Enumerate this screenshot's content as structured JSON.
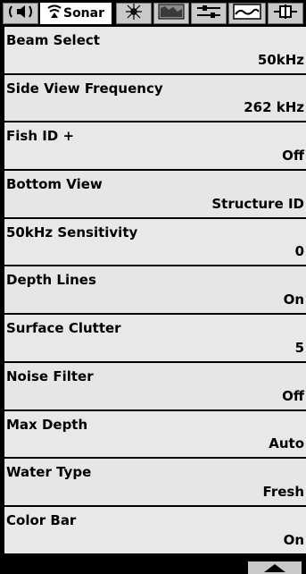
{
  "tabs": [
    {
      "name": "tab-alarms",
      "icon": "speaker-alarm-icon",
      "label": "",
      "active": false
    },
    {
      "name": "tab-sonar",
      "icon": "sonar-icon",
      "label": "Sonar",
      "active": true
    },
    {
      "name": "tab-navigation",
      "icon": "compass-icon",
      "label": "",
      "active": false
    },
    {
      "name": "tab-chart",
      "icon": "map-icon",
      "label": "",
      "active": false
    },
    {
      "name": "tab-setup",
      "icon": "sliders-icon",
      "label": "",
      "active": false
    },
    {
      "name": "tab-views",
      "icon": "wave-picture-icon",
      "label": "",
      "active": false
    },
    {
      "name": "tab-accessories",
      "icon": "accessory-plug-icon",
      "label": "",
      "active": false
    }
  ],
  "menu": {
    "items": [
      {
        "label": "Beam Select",
        "value": "50kHz"
      },
      {
        "label": "Side View Frequency",
        "value": "262 kHz"
      },
      {
        "label": "Fish ID +",
        "value": "Off"
      },
      {
        "label": "Bottom View",
        "value": "Structure ID"
      },
      {
        "label": "50kHz Sensitivity",
        "value": "0"
      },
      {
        "label": "Depth Lines",
        "value": "On"
      },
      {
        "label": "Surface Clutter",
        "value": "5"
      },
      {
        "label": "Noise Filter",
        "value": "Off"
      },
      {
        "label": "Max Depth",
        "value": "Auto"
      },
      {
        "label": "Water Type",
        "value": "Fresh"
      },
      {
        "label": "Color Bar",
        "value": "On"
      }
    ]
  },
  "scroll": {
    "icon": "scroll-up-arrow-icon"
  }
}
